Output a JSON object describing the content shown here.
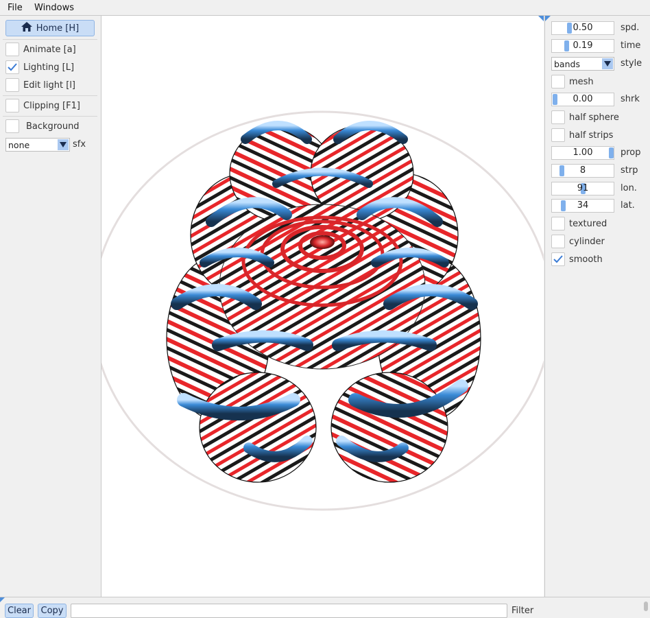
{
  "menu": {
    "file": "File",
    "windows": "Windows"
  },
  "left": {
    "home_label": "Home [H]",
    "animate_label": "Animate [a]",
    "lighting_label": "Lighting [L]",
    "lighting_checked": true,
    "edit_light_label": "Edit light [l]",
    "clipping_label": "Clipping [F1]",
    "background_label": "Background",
    "sfx_value": "none",
    "sfx_label": "sfx"
  },
  "right": {
    "spd_value": "0.50",
    "spd_label": "spd.",
    "spd_level": 0.5,
    "time_value": "0.19",
    "time_label": "time",
    "time_level": 0.19,
    "style_value": "bands",
    "style_label": "style",
    "mesh_label": "mesh",
    "shrk_value": "0.00",
    "shrk_label": "shrk",
    "shrk_level": 0.0,
    "half_sphere_label": "half sphere",
    "half_strips_label": "half strips",
    "prop_value": "1.00",
    "prop_label": "prop",
    "prop_level": 1.0,
    "strp_value": "8",
    "strp_label": "strp",
    "lon_value": "91",
    "lon_label": "lon.",
    "lat_value": "34",
    "lat_label": "lat.",
    "textured_label": "textured",
    "cylinder_label": "cylinder",
    "smooth_label": "smooth",
    "smooth_checked": true
  },
  "bottom": {
    "clear_label": "Clear",
    "copy_label": "Copy",
    "filter_value": "",
    "filter_label": "Filter"
  },
  "colors": {
    "accent": "#c9ddf6",
    "stripe_blue": "#3a8ad6",
    "stripe_red": "#e8262a",
    "stripe_black": "#1a1a1a"
  },
  "icons": [
    "home-icon",
    "check-icon",
    "dropdown-arrow-icon"
  ]
}
